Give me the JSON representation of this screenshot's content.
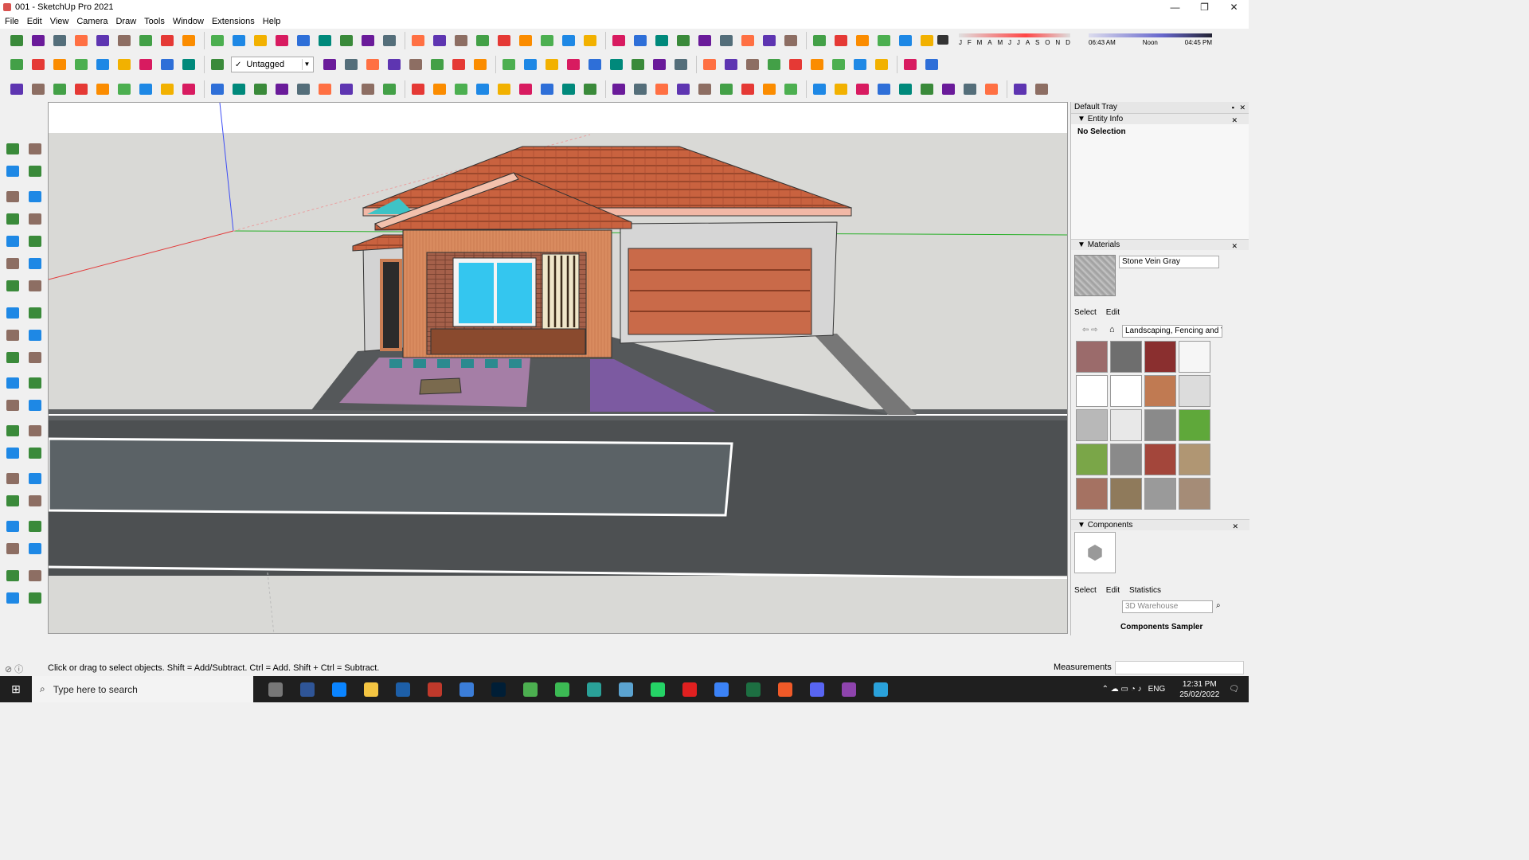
{
  "window": {
    "title": "001 - SketchUp Pro 2021",
    "minimize": "—",
    "maximize": "❐",
    "close": "✕"
  },
  "menu": [
    "File",
    "Edit",
    "View",
    "Camera",
    "Draw",
    "Tools",
    "Window",
    "Extensions",
    "Help"
  ],
  "tag_dropdown": {
    "check": "✓",
    "value": "Untagged"
  },
  "shadows": {
    "months": [
      "J",
      "F",
      "M",
      "A",
      "M",
      "J",
      "J",
      "A",
      "S",
      "O",
      "N",
      "D"
    ],
    "time_start": "06:43 AM",
    "time_mid": "Noon",
    "time_end": "04:45 PM"
  },
  "tray": {
    "title": "Default Tray",
    "entity_info": {
      "header": "Entity Info",
      "selection": "No Selection"
    },
    "materials": {
      "header": "Materials",
      "name": "Stone Vein Gray",
      "tab_select": "Select",
      "tab_edit": "Edit",
      "library": "Landscaping, Fencing and Vegetation",
      "swatch_colors": [
        "#9b6b6b",
        "#6e6e6e",
        "#8a2f2f",
        "#f6f6f6",
        "#ffffff",
        "#ffffff",
        "#c07a52",
        "#dcdcdc",
        "#b8b8b8",
        "#e8e8e8",
        "#8a8a8a",
        "#5fa83a",
        "#7aa648",
        "#8a8a8a",
        "#a3463b",
        "#b09673",
        "#a57262",
        "#8f7a5b",
        "#9a9a9a",
        "#a58c77"
      ]
    },
    "components": {
      "header": "Components",
      "tab_select": "Select",
      "tab_edit": "Edit",
      "tab_statistics": "Statistics",
      "search_placeholder": "3D Warehouse",
      "sampler": "Components Sampler"
    }
  },
  "status": {
    "hint": "Click or drag to select objects. Shift = Add/Subtract. Ctrl = Add. Shift + Ctrl = Subtract.",
    "measurements_label": "Measurements",
    "measurements_value": ""
  },
  "taskbar": {
    "search_placeholder": "Type here to search",
    "language": "ENG",
    "time": "12:31 PM",
    "date": "25/02/2022"
  }
}
